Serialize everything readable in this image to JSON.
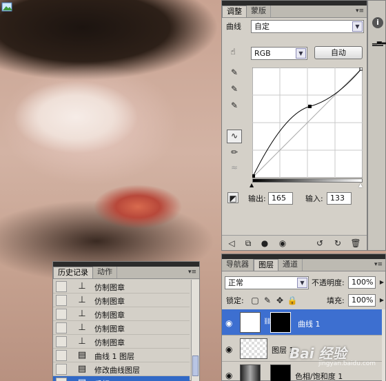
{
  "adjustments_panel": {
    "tabs": [
      "调整",
      "蒙版"
    ],
    "title": "曲线",
    "preset": "自定",
    "channel": "RGB",
    "auto_button": "自动",
    "output_label": "输出:",
    "output_value": "165",
    "input_label": "输入:",
    "input_value": "133",
    "curve_point": {
      "input": 133,
      "output": 165
    }
  },
  "history_panel": {
    "tabs": [
      "历史记录",
      "动作"
    ],
    "items": [
      {
        "label": "仿制图章",
        "icon": "stamp-icon"
      },
      {
        "label": "仿制图章",
        "icon": "stamp-icon"
      },
      {
        "label": "仿制图章",
        "icon": "stamp-icon"
      },
      {
        "label": "仿制图章",
        "icon": "stamp-icon"
      },
      {
        "label": "仿制图章",
        "icon": "stamp-icon"
      },
      {
        "label": "曲线 1 图层",
        "icon": "document-icon"
      },
      {
        "label": "修改曲线图层",
        "icon": "document-icon"
      },
      {
        "label": "反相",
        "icon": "document-icon"
      }
    ]
  },
  "layers_panel": {
    "tabs": [
      "导航器",
      "图层",
      "通道"
    ],
    "blend_mode": "正常",
    "opacity_label": "不透明度:",
    "opacity_value": "100%",
    "lock_label": "锁定:",
    "fill_label": "填充:",
    "fill_value": "100%",
    "layers": [
      {
        "name": "曲线 1"
      },
      {
        "name": "图层 1"
      },
      {
        "name": "色相/饱和度 1"
      }
    ]
  },
  "watermark": {
    "text": "Bai 经验",
    "url": "jingyan.baidu.com"
  }
}
